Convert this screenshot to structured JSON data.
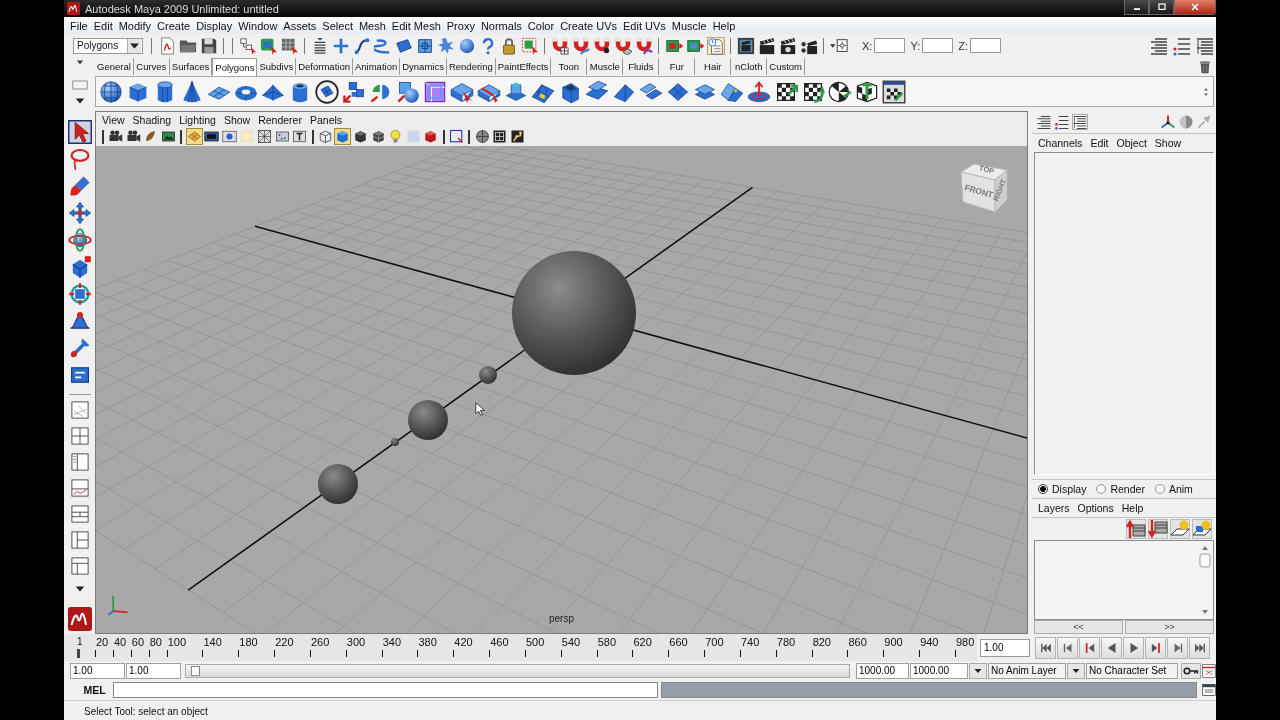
{
  "window": {
    "title": "Autodesk Maya 2009 Unlimited: untitled"
  },
  "menu_bar": [
    "File",
    "Edit",
    "Modify",
    "Create",
    "Display",
    "Window",
    "Assets",
    "Select",
    "Mesh",
    "Edit Mesh",
    "Proxy",
    "Normals",
    "Color",
    "Create UVs",
    "Edit UVs",
    "Muscle",
    "Help"
  ],
  "status_line": {
    "menu_set": "Polygons",
    "history_toggle": {
      "on": true
    },
    "coordinate_fields": [
      {
        "label": "X:"
      },
      {
        "label": "Y:"
      },
      {
        "label": "Z:"
      }
    ]
  },
  "shelf": {
    "tabs": [
      {
        "label": "General",
        "selected": false
      },
      {
        "label": "Curves",
        "selected": false
      },
      {
        "label": "Surfaces",
        "selected": false
      },
      {
        "label": "Polygons",
        "selected": true
      },
      {
        "label": "Subdivs",
        "selected": false
      },
      {
        "label": "Deformation",
        "selected": false
      },
      {
        "label": "Animation",
        "selected": false
      },
      {
        "label": "Dynamics",
        "selected": false
      },
      {
        "label": "Rendering",
        "selected": false
      },
      {
        "label": "PaintEffects",
        "selected": false
      },
      {
        "label": "Toon",
        "selected": false
      },
      {
        "label": "Muscle",
        "selected": false
      },
      {
        "label": "Fluids",
        "selected": false
      },
      {
        "label": "Fur",
        "selected": false
      },
      {
        "label": "Hair",
        "selected": false
      },
      {
        "label": "nCloth",
        "selected": false
      },
      {
        "label": "Custom",
        "selected": false
      }
    ]
  },
  "toolbox": {
    "tools": [
      {
        "selected": true
      },
      {
        "selected": false
      },
      {
        "selected": false
      },
      {
        "selected": false
      },
      {
        "selected": false
      },
      {
        "selected": false
      },
      {
        "selected": false
      },
      {
        "selected": false
      },
      {
        "selected": false
      },
      {
        "selected": false
      }
    ]
  },
  "viewport": {
    "menus": [
      "View",
      "Shading",
      "Lighting",
      "Show",
      "Renderer",
      "Panels"
    ],
    "toolbar_toggles": [
      {
        "on": true
      },
      {
        "on": false
      },
      {
        "on": false
      },
      {
        "on": false
      },
      {
        "on": false
      },
      {
        "on": false
      },
      {
        "on": false
      },
      {
        "on": false
      },
      {
        "on": true
      },
      {
        "on": false
      },
      {
        "on": false
      },
      {
        "on": false
      },
      {
        "on": false
      },
      {
        "on": false
      },
      {
        "on": false
      },
      {
        "on": false
      },
      {
        "on": false
      },
      {
        "on": false
      }
    ],
    "view_cube": {
      "faces": [
        "TOP",
        "FRONT",
        "RIGHT"
      ]
    },
    "camera_label": "persp"
  },
  "channel_box": {
    "layout_buttons": [
      {
        "selected": false
      },
      {
        "selected": false
      },
      {
        "selected": true
      }
    ],
    "menus": [
      "Channels",
      "Edit",
      "Object",
      "Show"
    ]
  },
  "layer_editor": {
    "modes": [
      {
        "label": "Display",
        "selected": true
      },
      {
        "label": "Render",
        "selected": false
      },
      {
        "label": "Anim",
        "selected": false
      }
    ],
    "menus": [
      "Layers",
      "Options",
      "Help"
    ],
    "scroll_buttons": [
      "<<",
      ">>"
    ]
  },
  "time_slider": {
    "level": 0,
    "current_time_label": "1",
    "ticks": [
      "20",
      "40",
      "60",
      "80",
      "100",
      "140",
      "180",
      "220",
      "260",
      "300",
      "340",
      "380",
      "420",
      "460",
      "500",
      "540",
      "580",
      "620",
      "660",
      "700",
      "740",
      "780",
      "820",
      "860",
      "900",
      "940",
      "980"
    ],
    "current_frame": "1.00"
  },
  "range_slider": {
    "start_time": "1.00",
    "range_start": "1.00",
    "range_end": "1000.00",
    "end_time": "1000.00",
    "anim_layer": "No Anim Layer",
    "character_set": "No Character Set"
  },
  "command_line": {
    "language": "MEL"
  },
  "help_line": "Select Tool: select an object"
}
